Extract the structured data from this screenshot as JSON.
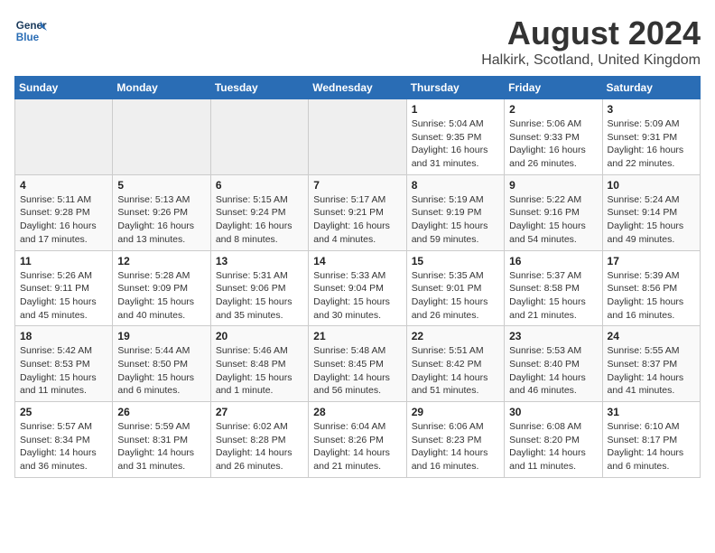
{
  "header": {
    "logo_line1": "General",
    "logo_line2": "Blue",
    "title": "August 2024",
    "subtitle": "Halkirk, Scotland, United Kingdom"
  },
  "columns": [
    "Sunday",
    "Monday",
    "Tuesday",
    "Wednesday",
    "Thursday",
    "Friday",
    "Saturday"
  ],
  "weeks": [
    [
      {
        "day": "",
        "info": ""
      },
      {
        "day": "",
        "info": ""
      },
      {
        "day": "",
        "info": ""
      },
      {
        "day": "",
        "info": ""
      },
      {
        "day": "1",
        "info": "Sunrise: 5:04 AM\nSunset: 9:35 PM\nDaylight: 16 hours\nand 31 minutes."
      },
      {
        "day": "2",
        "info": "Sunrise: 5:06 AM\nSunset: 9:33 PM\nDaylight: 16 hours\nand 26 minutes."
      },
      {
        "day": "3",
        "info": "Sunrise: 5:09 AM\nSunset: 9:31 PM\nDaylight: 16 hours\nand 22 minutes."
      }
    ],
    [
      {
        "day": "4",
        "info": "Sunrise: 5:11 AM\nSunset: 9:28 PM\nDaylight: 16 hours\nand 17 minutes."
      },
      {
        "day": "5",
        "info": "Sunrise: 5:13 AM\nSunset: 9:26 PM\nDaylight: 16 hours\nand 13 minutes."
      },
      {
        "day": "6",
        "info": "Sunrise: 5:15 AM\nSunset: 9:24 PM\nDaylight: 16 hours\nand 8 minutes."
      },
      {
        "day": "7",
        "info": "Sunrise: 5:17 AM\nSunset: 9:21 PM\nDaylight: 16 hours\nand 4 minutes."
      },
      {
        "day": "8",
        "info": "Sunrise: 5:19 AM\nSunset: 9:19 PM\nDaylight: 15 hours\nand 59 minutes."
      },
      {
        "day": "9",
        "info": "Sunrise: 5:22 AM\nSunset: 9:16 PM\nDaylight: 15 hours\nand 54 minutes."
      },
      {
        "day": "10",
        "info": "Sunrise: 5:24 AM\nSunset: 9:14 PM\nDaylight: 15 hours\nand 49 minutes."
      }
    ],
    [
      {
        "day": "11",
        "info": "Sunrise: 5:26 AM\nSunset: 9:11 PM\nDaylight: 15 hours\nand 45 minutes."
      },
      {
        "day": "12",
        "info": "Sunrise: 5:28 AM\nSunset: 9:09 PM\nDaylight: 15 hours\nand 40 minutes."
      },
      {
        "day": "13",
        "info": "Sunrise: 5:31 AM\nSunset: 9:06 PM\nDaylight: 15 hours\nand 35 minutes."
      },
      {
        "day": "14",
        "info": "Sunrise: 5:33 AM\nSunset: 9:04 PM\nDaylight: 15 hours\nand 30 minutes."
      },
      {
        "day": "15",
        "info": "Sunrise: 5:35 AM\nSunset: 9:01 PM\nDaylight: 15 hours\nand 26 minutes."
      },
      {
        "day": "16",
        "info": "Sunrise: 5:37 AM\nSunset: 8:58 PM\nDaylight: 15 hours\nand 21 minutes."
      },
      {
        "day": "17",
        "info": "Sunrise: 5:39 AM\nSunset: 8:56 PM\nDaylight: 15 hours\nand 16 minutes."
      }
    ],
    [
      {
        "day": "18",
        "info": "Sunrise: 5:42 AM\nSunset: 8:53 PM\nDaylight: 15 hours\nand 11 minutes."
      },
      {
        "day": "19",
        "info": "Sunrise: 5:44 AM\nSunset: 8:50 PM\nDaylight: 15 hours\nand 6 minutes."
      },
      {
        "day": "20",
        "info": "Sunrise: 5:46 AM\nSunset: 8:48 PM\nDaylight: 15 hours\nand 1 minute."
      },
      {
        "day": "21",
        "info": "Sunrise: 5:48 AM\nSunset: 8:45 PM\nDaylight: 14 hours\nand 56 minutes."
      },
      {
        "day": "22",
        "info": "Sunrise: 5:51 AM\nSunset: 8:42 PM\nDaylight: 14 hours\nand 51 minutes."
      },
      {
        "day": "23",
        "info": "Sunrise: 5:53 AM\nSunset: 8:40 PM\nDaylight: 14 hours\nand 46 minutes."
      },
      {
        "day": "24",
        "info": "Sunrise: 5:55 AM\nSunset: 8:37 PM\nDaylight: 14 hours\nand 41 minutes."
      }
    ],
    [
      {
        "day": "25",
        "info": "Sunrise: 5:57 AM\nSunset: 8:34 PM\nDaylight: 14 hours\nand 36 minutes."
      },
      {
        "day": "26",
        "info": "Sunrise: 5:59 AM\nSunset: 8:31 PM\nDaylight: 14 hours\nand 31 minutes."
      },
      {
        "day": "27",
        "info": "Sunrise: 6:02 AM\nSunset: 8:28 PM\nDaylight: 14 hours\nand 26 minutes."
      },
      {
        "day": "28",
        "info": "Sunrise: 6:04 AM\nSunset: 8:26 PM\nDaylight: 14 hours\nand 21 minutes."
      },
      {
        "day": "29",
        "info": "Sunrise: 6:06 AM\nSunset: 8:23 PM\nDaylight: 14 hours\nand 16 minutes."
      },
      {
        "day": "30",
        "info": "Sunrise: 6:08 AM\nSunset: 8:20 PM\nDaylight: 14 hours\nand 11 minutes."
      },
      {
        "day": "31",
        "info": "Sunrise: 6:10 AM\nSunset: 8:17 PM\nDaylight: 14 hours\nand 6 minutes."
      }
    ]
  ]
}
